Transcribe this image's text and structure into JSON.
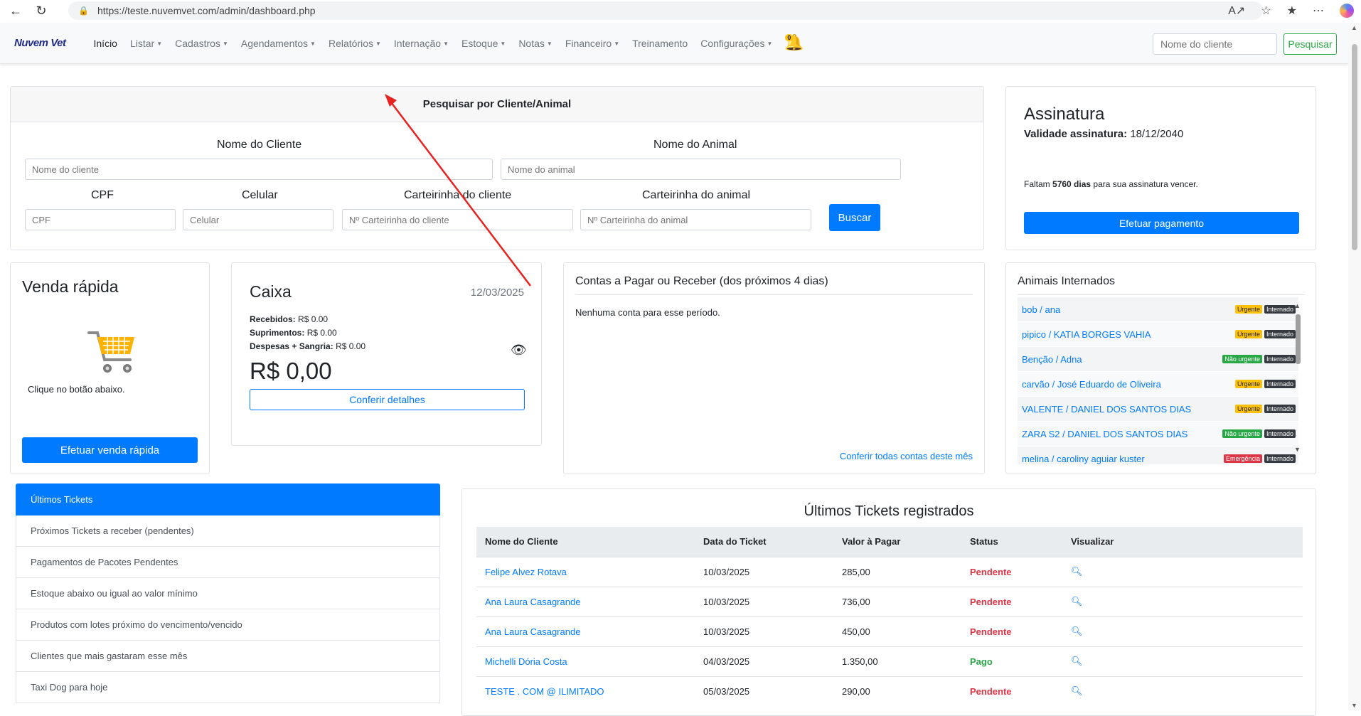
{
  "browser": {
    "url": "https://teste.nuvemvet.com/admin/dashboard.php"
  },
  "navbar": {
    "brand_a": "Nuvem",
    "brand_b": "Vet",
    "items": [
      {
        "label": "Início",
        "caret": false,
        "active": true
      },
      {
        "label": "Listar",
        "caret": true
      },
      {
        "label": "Cadastros",
        "caret": true
      },
      {
        "label": "Agendamentos",
        "caret": true
      },
      {
        "label": "Relatórios",
        "caret": true
      },
      {
        "label": "Internação",
        "caret": true
      },
      {
        "label": "Estoque",
        "caret": true
      },
      {
        "label": "Notas",
        "caret": true
      },
      {
        "label": "Financeiro",
        "caret": true
      },
      {
        "label": "Treinamento",
        "caret": false
      },
      {
        "label": "Configurações",
        "caret": true
      }
    ],
    "bell_badge": "0",
    "search_placeholder": "Nome do cliente",
    "search_button": "Pesquisar"
  },
  "search_card": {
    "header": "Pesquisar por Cliente/Animal",
    "client_label": "Nome do Cliente",
    "client_placeholder": "Nome do cliente",
    "animal_label": "Nome do Animal",
    "animal_placeholder": "Nome do animal",
    "cpf_label": "CPF",
    "cpf_placeholder": "CPF",
    "phone_label": "Celular",
    "phone_placeholder": "Celular",
    "client_card_label": "Carteirinha do cliente",
    "client_card_placeholder": "Nº Carteirinha do cliente",
    "animal_card_label": "Carteirinha do animal",
    "animal_card_placeholder": "Nº Carteirinha do animal",
    "button": "Buscar"
  },
  "subscription": {
    "title": "Assinatura",
    "validity_label": "Validade assinatura:",
    "validity_value": "18/12/2040",
    "days_prefix": "Faltam",
    "days_value": "5760 dias",
    "days_suffix": "para sua assinatura vencer.",
    "button": "Efetuar pagamento"
  },
  "quick_sale": {
    "title": "Venda rápida",
    "hint": "Clique no botão abaixo.",
    "button": "Efetuar venda rápida"
  },
  "cash": {
    "title": "Caixa",
    "date": "12/03/2025",
    "received_label": "Recebidos:",
    "received_value": "R$ 0.00",
    "supplies_label": "Suprimentos:",
    "supplies_value": "R$ 0.00",
    "expenses_label": "Despesas + Sangria:",
    "expenses_value": "R$ 0.00",
    "total": "R$ 0,00",
    "button": "Conferir detalhes"
  },
  "accounts": {
    "title": "Contas a Pagar ou Receber (dos próximos 4 dias)",
    "empty": "Nenhuma conta para esse período.",
    "link": "Conferir todas contas deste mês"
  },
  "hospitalized": {
    "title": "Animais Internados",
    "rows": [
      {
        "name": "bob / ana",
        "priority": "Urgente",
        "ptype": "urg",
        "status": "Internado"
      },
      {
        "name": "pipico / KATIA BORGES VAHIA",
        "priority": "Urgente",
        "ptype": "urg",
        "status": "Internado"
      },
      {
        "name": "Benção / Adna",
        "priority": "Não urgente",
        "ptype": "nurg",
        "status": "Internado"
      },
      {
        "name": "carvão / José Eduardo de Oliveira",
        "priority": "Urgente",
        "ptype": "urg",
        "status": "Internado"
      },
      {
        "name": "VALENTE / DANIEL DOS SANTOS DIAS",
        "priority": "Urgente",
        "ptype": "urg",
        "status": "Internado"
      },
      {
        "name": "ZARA S2 / DANIEL DOS SANTOS DIAS",
        "priority": "Não urgente",
        "ptype": "nurg",
        "status": "Internado"
      },
      {
        "name": "melina / caroliny aguiar kuster",
        "priority": "Emergência",
        "ptype": "emg",
        "status": "Internado"
      }
    ]
  },
  "side_list": {
    "items": [
      "Últimos Tickets",
      "Próximos Tickets a receber (pendentes)",
      "Pagamentos de Pacotes Pendentes",
      "Estoque abaixo ou igual ao valor mínimo",
      "Produtos com lotes próximo do vencimento/vencido",
      "Clientes que mais gastaram esse mês",
      "Taxi Dog para hoje"
    ]
  },
  "tickets": {
    "title": "Últimos Tickets registrados",
    "columns": [
      "Nome do Cliente",
      "Data do Ticket",
      "Valor à Pagar",
      "Status",
      "Visualizar"
    ],
    "rows": [
      {
        "client": "Felipe Alvez Rotava",
        "date": "10/03/2025",
        "value": "285,00",
        "status": "Pendente"
      },
      {
        "client": "Ana Laura Casagrande",
        "date": "10/03/2025",
        "value": "736,00",
        "status": "Pendente"
      },
      {
        "client": "Ana Laura Casagrande",
        "date": "10/03/2025",
        "value": "450,00",
        "status": "Pendente"
      },
      {
        "client": "Michelli Dória Costa",
        "date": "04/03/2025",
        "value": "1.350,00",
        "status": "Pago"
      },
      {
        "client": "TESTE . COM @ ILIMITADO",
        "date": "05/03/2025",
        "value": "290,00",
        "status": "Pendente"
      }
    ]
  },
  "colors": {
    "primary": "#007bff",
    "success": "#28a745",
    "danger": "#dc3545",
    "warning": "#ffc107",
    "annotation_arrow": "#e8231f"
  }
}
